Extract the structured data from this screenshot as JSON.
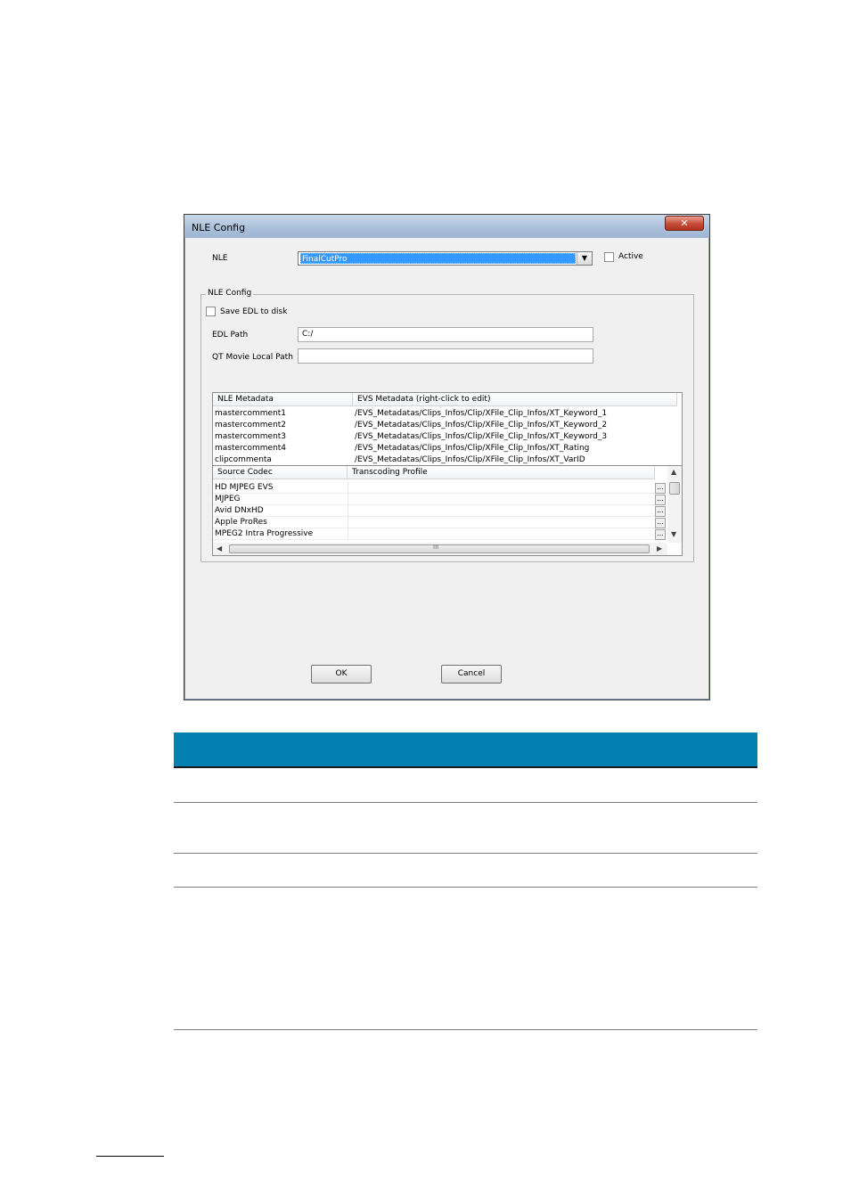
{
  "window": {
    "title": "NLE Config",
    "close_glyph": "✕"
  },
  "nle_row": {
    "label": "NLE",
    "selected_value": "FinalCutPro",
    "active_label": "Active"
  },
  "group": {
    "legend": "NLE Config",
    "save_edl_label": "Save EDL to disk",
    "edl_path_label": "EDL Path",
    "edl_path_value": "C:/",
    "qt_path_label": "QT Movie Local Path",
    "qt_path_value": ""
  },
  "metadata_grid": {
    "headers": [
      "NLE Metadata",
      "EVS Metadata    (right-click to edit)"
    ],
    "rows": [
      [
        "mastercomment1",
        "/EVS_Metadatas/Clips_Infos/Clip/XFile_Clip_Infos/XT_Keyword_1"
      ],
      [
        "mastercomment2",
        "/EVS_Metadatas/Clips_Infos/Clip/XFile_Clip_Infos/XT_Keyword_2"
      ],
      [
        "mastercomment3",
        "/EVS_Metadatas/Clips_Infos/Clip/XFile_Clip_Infos/XT_Keyword_3"
      ],
      [
        "mastercomment4",
        "/EVS_Metadatas/Clips_Infos/Clip/XFile_Clip_Infos/XT_Rating"
      ],
      [
        "clipcommenta",
        "/EVS_Metadatas/Clips_Infos/Clip/XFile_Clip_Infos/XT_VarID"
      ]
    ]
  },
  "codec_grid": {
    "headers": [
      "Source Codec",
      "Transcoding Profile"
    ],
    "rows": [
      [
        "HD MJPEG EVS",
        ""
      ],
      [
        "MJPEG",
        ""
      ],
      [
        "Avid DNxHD",
        ""
      ],
      [
        "Apple ProRes",
        ""
      ],
      [
        "MPEG2 Intra Progressive",
        ""
      ]
    ],
    "ellipsis": "...",
    "hscroll_grip": "III"
  },
  "buttons": {
    "ok": "OK",
    "cancel": "Cancel"
  },
  "colors": {
    "table_header": "#0281b0",
    "selection": "#3399ff"
  }
}
